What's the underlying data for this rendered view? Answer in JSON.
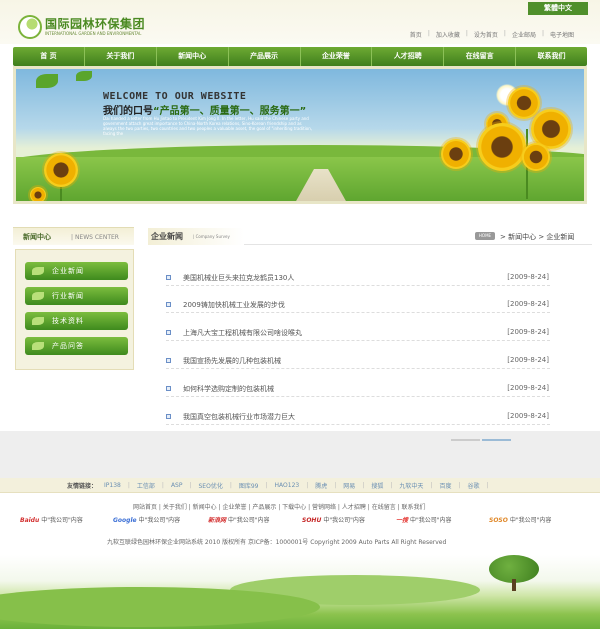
{
  "header": {
    "logo_cn": "国际园林环保集团",
    "logo_en": "INTERNATIONAL GARDEN AND ENVIRONMENTAL",
    "lang_button": "繁體中文",
    "top_links": [
      "首页",
      "加入收藏",
      "设为首页",
      "企业邮局",
      "电子地图"
    ]
  },
  "nav": {
    "items": [
      "首 页",
      "关于我们",
      "新闻中心",
      "产品展示",
      "企业荣誉",
      "人才招聘",
      "在线留言",
      "联系我们"
    ]
  },
  "banner": {
    "title": "WELCOME TO OUR WEBSITE",
    "slogan_prefix": "我们的口号",
    "slogan": "“产品第一、质量第一、服务第一”",
    "desc": "Dai handed a letter from Hu Jintao to President Kim Jong Il. In the letter, Hu said the Chinese party and government attach great importance to China-North Korea relations, Sino-Korean friendship and as always the two parties, two countries and two peoples a valuable asset, the goal of \"inheriting tradition, facing the"
  },
  "sidebar": {
    "heading_cn": "新闻中心",
    "heading_en": "NEWS CENTER",
    "items": [
      "企业新闻",
      "行业新闻",
      "技术资料",
      "产品问答"
    ]
  },
  "content": {
    "title": "企业新闻",
    "subtitle": "Company Survey",
    "home_pill": "HOME",
    "breadcrumb": "> 新闻中心 > 企业新闻",
    "news": [
      {
        "title": "美国机械业巨头来拉克龙鹤员130人",
        "date": "[2009-8-24]"
      },
      {
        "title": "2009铸加快机械工业发展的步伐",
        "date": "[2009-8-24]"
      },
      {
        "title": "上海凡大宝工程机械有限公司啥设喉丸",
        "date": "[2009-8-24]"
      },
      {
        "title": "我国宣扬先发展的几种包装机械",
        "date": "[2009-8-24]"
      },
      {
        "title": "如何科学选购定制的包装机械",
        "date": "[2009-8-24]"
      },
      {
        "title": "我国真空包装机械行业市场潜力巨大",
        "date": "[2009-8-24]"
      }
    ]
  },
  "links": {
    "label": "友情链接：",
    "items": [
      "IP138",
      "工信部",
      "ASP",
      "SEO优化",
      "图库99",
      "HAO123",
      "腾虎",
      "网易",
      "搜狐",
      "九软中天",
      "百度",
      "谷歌"
    ]
  },
  "footer": {
    "nav": "网站首页 | 关于我们 | 新闻中心 | 企业荣誉 | 产品展示 | 下载中心 | 营销网络 | 人才招聘 | 在线留言 | 联系我们",
    "partners": [
      {
        "brand": "Baidu",
        "text": "中\"我公司\"内容",
        "color": "#d32f2f"
      },
      {
        "brand": "Google",
        "text": "中\"我公司\"内容",
        "color": "#3b6fd6"
      },
      {
        "brand": "新浪网",
        "text": "中\"我公司\"内容",
        "color": "#d32f2f"
      },
      {
        "brand": "SOHU",
        "text": "中\"我公司\"内容",
        "color": "#c62828"
      },
      {
        "brand": "一搜",
        "text": "中\"我公司\"内容",
        "color": "#e53935"
      },
      {
        "brand": "SOSO",
        "text": "中\"我公司\"内容",
        "color": "#e0892b"
      }
    ],
    "copyright": "九软互联绿色园林环保企业网站系统 2010 版权所有 京ICP备：1000001号 Copyright 2009 Auto Parts All Right Reserved"
  }
}
